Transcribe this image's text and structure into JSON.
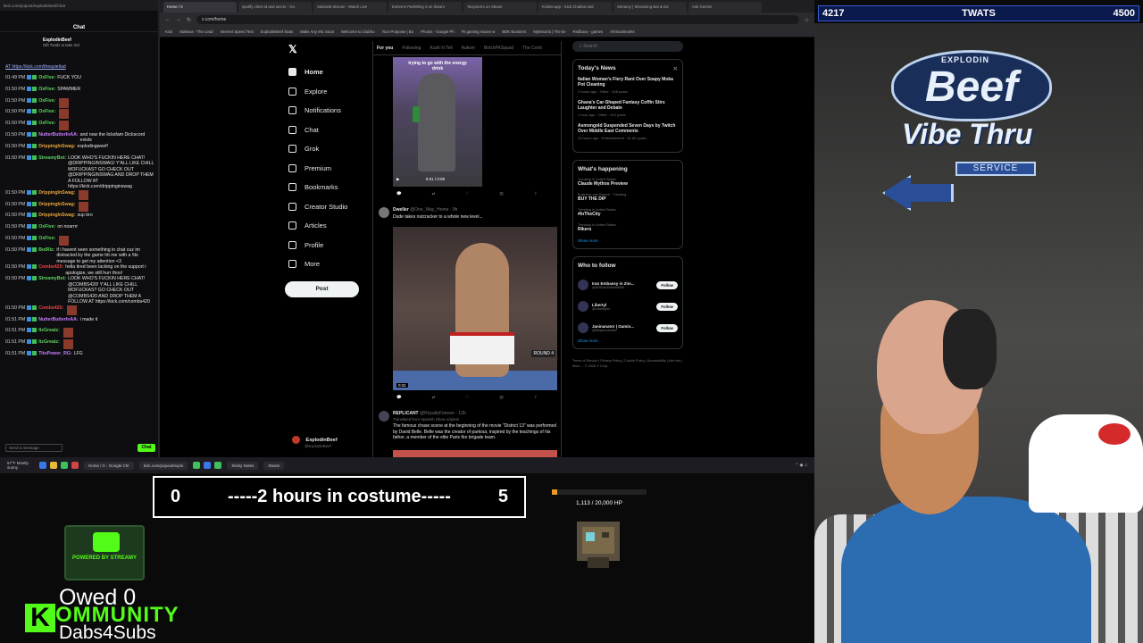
{
  "chat": {
    "window_url": "kick.com/popout/explodinbeef/chat",
    "title": "Chat",
    "channel": "ExplodinBeef",
    "channel_sub": "Gift Toads to take 3rd",
    "link": "AT https://kick.com/thequietlad",
    "lines": [
      {
        "ts": "01:49 PM",
        "user": "OxFive:",
        "ucolor": "#5fd35f",
        "msg": "FUCK YOU",
        "emote": false
      },
      {
        "ts": "01:50 PM",
        "user": "OxFive:",
        "ucolor": "#5fd35f",
        "msg": "SPAMMER",
        "emote": false
      },
      {
        "ts": "01:50 PM",
        "user": "OxFive:",
        "ucolor": "#5fd35f",
        "msg": "",
        "emote": true
      },
      {
        "ts": "01:50 PM",
        "user": "OxFive:",
        "ucolor": "#5fd35f",
        "msg": "",
        "emote": true
      },
      {
        "ts": "01:50 PM",
        "user": "OxFive:",
        "ucolor": "#5fd35f",
        "msg": "",
        "emote": true
      },
      {
        "ts": "01:50 PM",
        "user": "NutterButterInAA:",
        "ucolor": "#c77dff",
        "msg": "and now the licksfam Dickscord exists",
        "emote": false
      },
      {
        "ts": "01:50 PM",
        "user": "DrippingInSwag:",
        "ucolor": "#e8a33b",
        "msg": "explodingweef!",
        "emote": false
      },
      {
        "ts": "01:50 PM",
        "user": "StreamyBot:",
        "ucolor": "#5fd35f",
        "msg": "LOOK WHO'S FUCKIN HERE CHAT! @DRIPPINGINSWAG! Y'ALL LIKE CHILL MOFUCKAS? GO CHECK OUT @DRIPPINGINSWAG AND DROP THEM A FOLLOW AT https://kick.com/drippinginswag",
        "emote": false
      },
      {
        "ts": "01:50 PM",
        "user": "DrippingInSwag:",
        "ucolor": "#e8a33b",
        "msg": "",
        "emote": true
      },
      {
        "ts": "01:50 PM",
        "user": "DrippingInSwag:",
        "ucolor": "#e8a33b",
        "msg": "",
        "emote": true
      },
      {
        "ts": "01:50 PM",
        "user": "DrippingInSwag:",
        "ucolor": "#e8a33b",
        "msg": "sup bro",
        "emote": false
      },
      {
        "ts": "01:50 PM",
        "user": "OxFive:",
        "ucolor": "#5fd35f",
        "msg": "on noarrrr",
        "emote": false
      },
      {
        "ts": "01:50 PM",
        "user": "OxFive:",
        "ucolor": "#5fd35f",
        "msg": "",
        "emote": true
      },
      {
        "ts": "01:50 PM",
        "user": "BotRiz:",
        "ucolor": "#5fd35f",
        "msg": "if i havent seen something in chat cuz im distracted by the game hit me with a !tts message to get my attention <3",
        "emote": false
      },
      {
        "ts": "01:50 PM",
        "user": "Combs420:",
        "ucolor": "#e84545",
        "msg": "hella tired been lacking on the support i apologize, we still hurr thoo!",
        "emote": false
      },
      {
        "ts": "01:50 PM",
        "user": "StreamyBot:",
        "ucolor": "#5fd35f",
        "msg": "LOOK WHO'S FUCKIN HERE CHAT! @COMBS420! Y'ALL LIKE CHILL MOFUCKAS? GO CHECK OUT @COMBS420 AND DROP THEM A FOLLOW AT https://kick.com/combs420",
        "emote": false
      },
      {
        "ts": "01:50 PM",
        "user": "Combs420:",
        "ucolor": "#e84545",
        "msg": "",
        "emote": true
      },
      {
        "ts": "01:51 PM",
        "user": "NutterButterInAA:",
        "ucolor": "#c77dff",
        "msg": "i made it",
        "emote": false
      },
      {
        "ts": "01:51 PM",
        "user": "ItzGreatz:",
        "ucolor": "#5fd35f",
        "msg": "",
        "emote": true
      },
      {
        "ts": "01:51 PM",
        "user": "ItzGreatz:",
        "ucolor": "#5fd35f",
        "msg": "",
        "emote": true
      },
      {
        "ts": "01:51 PM",
        "user": "TitoPower_RG:",
        "ucolor": "#c77dff",
        "msg": "LFG",
        "emote": false
      }
    ],
    "input_placeholder": "Send a message",
    "send_label": "Chat"
  },
  "browser": {
    "tabs": [
      "Home / X",
      "spotify client id and secret - Go",
      "StationB Stream - Watch Live",
      "Extreme ParkWing 3 on Steam",
      "Tanystorm on Steam",
      "Kicklet.app - Kick Chatbot and",
      "Streamy | Streaming Bot & Da",
      "Ask Gemini"
    ],
    "url": "x.com/home",
    "bookmarks": [
      "Kick",
      "Stakeus - The Lead",
      "Internet Speed Test",
      "ExplodinBeef Stats",
      "Make Any Mic Soun",
      "Welcome to Clubho",
      "Your Porpoise | Bo",
      "Photos - Google Ph",
      "Fk gaming issues w",
      "BDK Boosters",
      "Mylestorts | The ke",
      "Redboxs - games",
      "All Bookmarks"
    ]
  },
  "x": {
    "nav": [
      {
        "label": "Home",
        "icon": "home-icon",
        "active": true
      },
      {
        "label": "Explore",
        "icon": "search-icon",
        "active": false
      },
      {
        "label": "Notifications",
        "icon": "bell-icon",
        "active": false
      },
      {
        "label": "Chat",
        "icon": "chat-icon",
        "active": false
      },
      {
        "label": "Grok",
        "icon": "grok-icon",
        "active": false
      },
      {
        "label": "Premium",
        "icon": "premium-icon",
        "active": false
      },
      {
        "label": "Bookmarks",
        "icon": "bookmark-icon",
        "active": false
      },
      {
        "label": "Creator Studio",
        "icon": "creator-icon",
        "active": false
      },
      {
        "label": "Articles",
        "icon": "articles-icon",
        "active": false
      },
      {
        "label": "Profile",
        "icon": "profile-icon",
        "active": false
      },
      {
        "label": "More",
        "icon": "more-icon",
        "active": false
      }
    ],
    "post_label": "Post",
    "account_name": "ExplodinBeef",
    "account_handle": "@ExplodinBeef",
    "feed_tabs": [
      "For you",
      "Following",
      "Kush N Tell",
      "Autism",
      "BotchPitSquad",
      "The Conti"
    ],
    "tweets": [
      {
        "video_time": "0:01 / 0:09",
        "caption": "trying to go with the energy drink"
      },
      {
        "name": "Dweller",
        "handle": "@One_Way_Home · 9h",
        "text": "Dude takes nutcracker to a whole new level...",
        "video_time": "0:31",
        "overlay": "ROUND 4"
      },
      {
        "name": "REPLICANT",
        "handle": "@RoyaltyForever · 12h",
        "translated": "Translated from Spanish Show original",
        "text": "The famous chase scene at the beginning of the movie \"District 13\" was performed by David Belle. Belle was the creator of parkour, inspired by the teachings of his father, a member of the elite Paris fire brigade team."
      }
    ],
    "search_placeholder": "Search",
    "news_title": "Today's News",
    "news": [
      {
        "title": "Italian Woman's Fiery Rant Over Soapy Moka Pot Cleaning",
        "meta": "2 hours ago · Other · 408 posts"
      },
      {
        "title": "Ghana's Car-Shaped Fantasy Coffin Stirs Laughter and Debate",
        "meta": "1 hour ago · Other · 412 posts"
      },
      {
        "title": "Asmongold Suspended Seven Days by Twitch Over Middle East Comments",
        "meta": "10 hours ago · Entertainment · 61.6K posts"
      }
    ],
    "happening_title": "What's happening",
    "trends": [
      {
        "cat": "Trending in United States",
        "name": "Claude Mythos Preview"
      },
      {
        "cat": "Business and finance · Trending",
        "name": "BUY THE DIP"
      },
      {
        "cat": "Trending in United States",
        "name": "#InTheCity"
      },
      {
        "cat": "Trending in United States",
        "name": "Rikers"
      }
    ],
    "show_more": "Show more",
    "follow_title": "Who to follow",
    "follows": [
      {
        "name": "Iran Embassy in Zim...",
        "handle": "@IRANinZIMBABWE"
      },
      {
        "name": "Libertyl",
        "handle": "@Libertylen"
      },
      {
        "name": "Janinanator | Gamin...",
        "handle": "@thejaninanator"
      }
    ],
    "follow_label": "Follow",
    "footer": "Terms of Service | Privacy Policy | Cookie Policy | Accessibility | Ads info | More ... © 2026 X Corp."
  },
  "taskbar": {
    "weather": "57°F Mostly sunny",
    "items": [
      "Home / X - Google Chr",
      "kick.com/popout/explo",
      "Sticky Notes",
      "Steam"
    ]
  },
  "overlay": {
    "counter_left": "4217",
    "counter_title": "TWATS",
    "counter_right": "4500",
    "costume_left": "0",
    "costume_text": "-----2 hours in costume-----",
    "costume_right": "5",
    "hp_text": "1,113 / 20,000 HP",
    "hp_fraction": 0.0557,
    "owed": "Owed 0",
    "kommunity_k": "K",
    "kommunity_rest": "OMMUNITY",
    "dabs": "Dabs4Subs",
    "streamy_caption": "POWERED BY STREAMY",
    "logo_top": "EXPLODIN",
    "logo_main": "Beef",
    "logo_vibe": "Vibe Thru",
    "logo_service": "SERVICE"
  },
  "colors": {
    "kick_green": "#53fc18",
    "x_blue": "#1d9bf0",
    "counter_bg": "#0b1a4d",
    "hp_orange": "#e89a2a"
  }
}
